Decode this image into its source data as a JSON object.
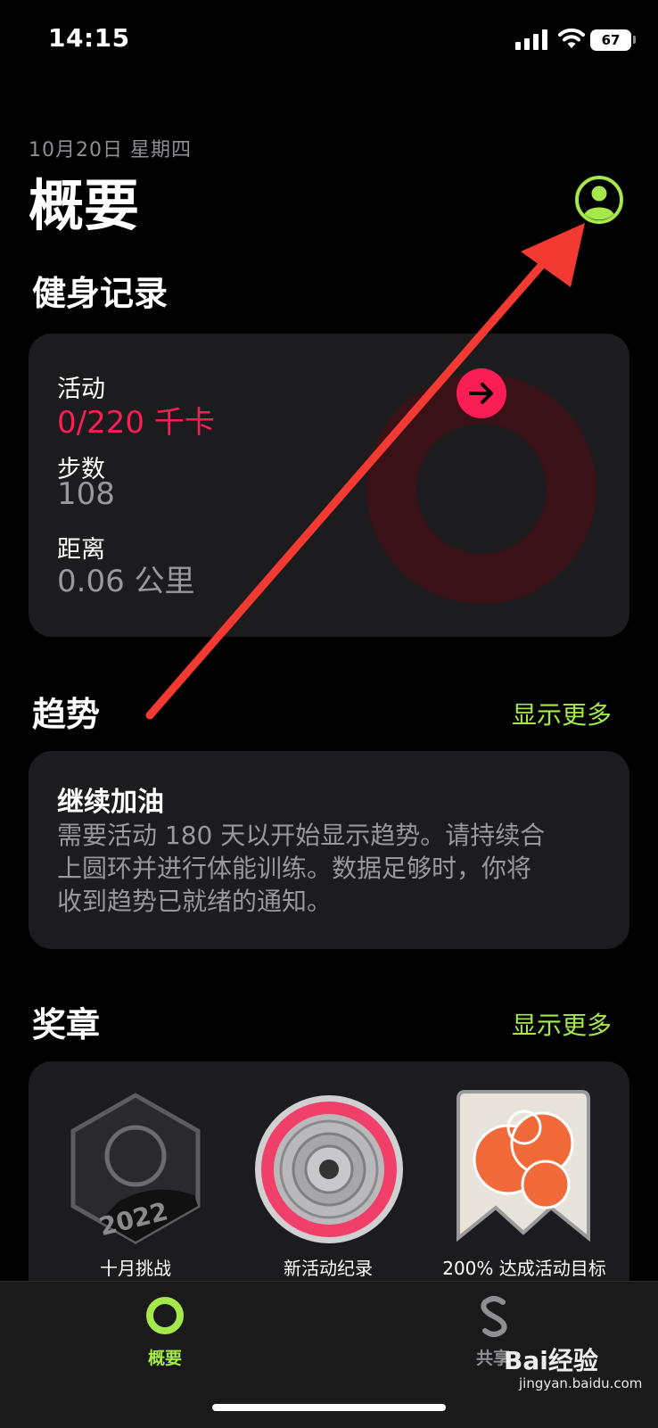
{
  "status_bar": {
    "time": "14:15",
    "battery": "67"
  },
  "header": {
    "date": "10月20日 星期四",
    "title": "概要",
    "profile_icon": "person-circle-icon",
    "accent": "#a4e84a"
  },
  "fitness": {
    "section_title": "健身记录",
    "activity_label": "活动",
    "activity_value": "0/220 千卡",
    "steps_label": "步数",
    "steps_value": "108",
    "distance_label": "距离",
    "distance_value": "0.06 公里",
    "move_ring_progress": 0,
    "ring_color": "#fa1e55"
  },
  "trends": {
    "section_title": "趋势",
    "show_more": "显示更多",
    "card_title": "继续加油",
    "card_line1": "需要活动 180 天以开始显示趋势。请持续合",
    "card_line2": "上圆环并进行体能训练。数据足够时，你将",
    "card_line3": "收到趋势已就绪的通知。"
  },
  "awards": {
    "section_title": "奖章",
    "show_more": "显示更多",
    "items": [
      {
        "label": "十月挑战",
        "icon": "hexagon-2022-badge-icon"
      },
      {
        "label": "新活动纪录",
        "icon": "pink-record-badge-icon"
      },
      {
        "label": "200% 达成活动目标",
        "icon": "orange-200-badge-icon"
      }
    ]
  },
  "tabbar": {
    "tabs": [
      {
        "label": "概要",
        "icon": "activity-ring-icon",
        "active": true
      },
      {
        "label": "共享",
        "icon": "sharing-s-icon",
        "active": false
      }
    ]
  },
  "watermark": {
    "brand": "Bai经验",
    "url": "jingyan.baidu.com"
  }
}
